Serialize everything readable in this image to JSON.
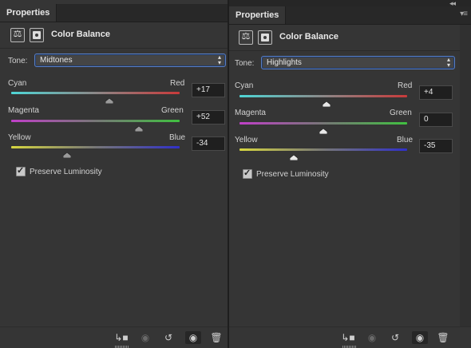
{
  "window": {
    "collapse_glyph": "◂◂",
    "menu_glyph": "▾≡"
  },
  "panels": [
    {
      "tab_label": "Properties",
      "title": "Color Balance",
      "tone_label": "Tone:",
      "tone_value": "Midtones",
      "sliders": [
        {
          "left_label": "Cyan",
          "right_label": "Red",
          "value": "+17",
          "level": 17
        },
        {
          "left_label": "Magenta",
          "right_label": "Green",
          "value": "+52",
          "level": 52
        },
        {
          "left_label": "Yellow",
          "right_label": "Blue",
          "value": "-34",
          "level": -34
        }
      ],
      "preserve_label": "Preserve Luminosity",
      "preserve_checked": true
    },
    {
      "tab_label": "Properties",
      "title": "Color Balance",
      "tone_label": "Tone:",
      "tone_value": "Highlights",
      "sliders": [
        {
          "left_label": "Cyan",
          "right_label": "Red",
          "value": "+4",
          "level": 4
        },
        {
          "left_label": "Magenta",
          "right_label": "Green",
          "value": "0",
          "level": 0
        },
        {
          "left_label": "Yellow",
          "right_label": "Blue",
          "value": "-35",
          "level": -35
        }
      ],
      "preserve_label": "Preserve Luminosity",
      "preserve_checked": true
    }
  ],
  "icons": {
    "adjustment": "color-balance-icon",
    "mask": "mask-icon",
    "clip": "clip-to-layer-icon",
    "view_previous": "view-previous-state-icon",
    "reset": "reset-icon",
    "visibility": "eye-icon",
    "delete": "trash-icon"
  },
  "colors": {
    "cyan_red": [
      "#4fd6d6",
      "#c83a3a"
    ],
    "magenta_green": [
      "#c040c8",
      "#40c040"
    ],
    "yellow_blue": [
      "#d6d640",
      "#3030c8"
    ]
  }
}
